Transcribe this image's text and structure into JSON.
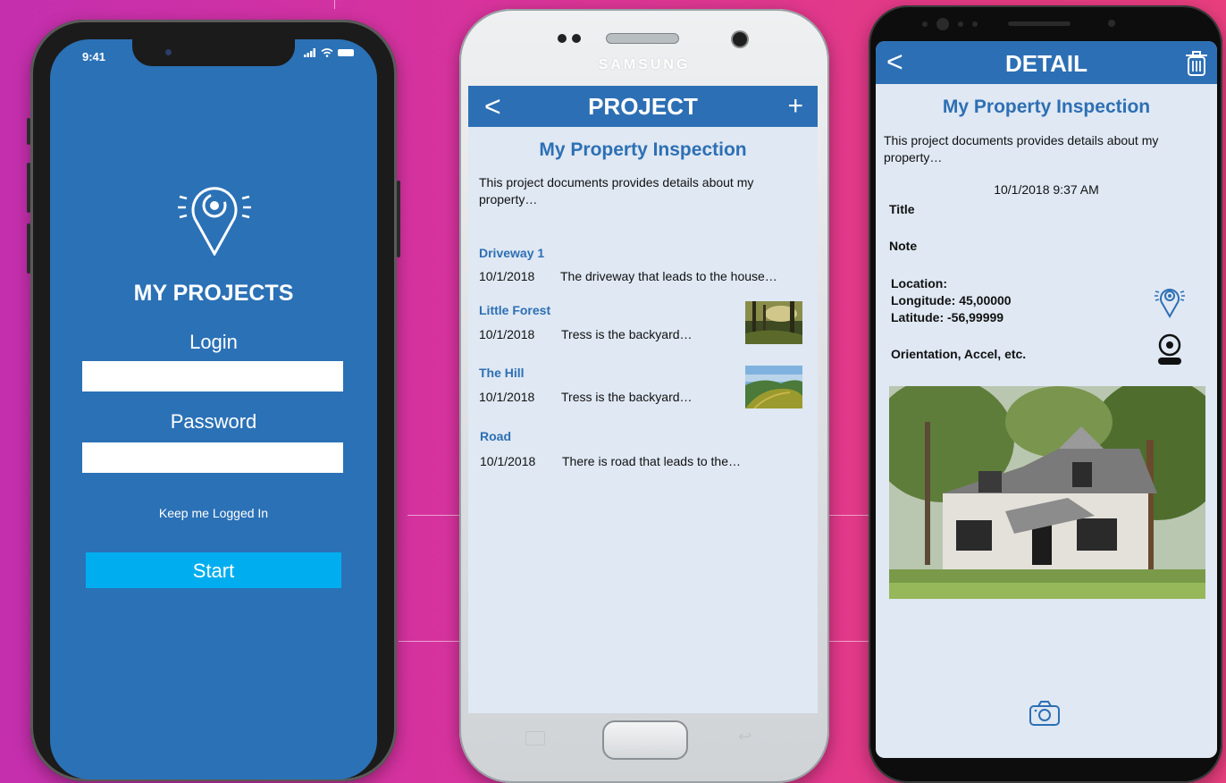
{
  "login_screen": {
    "status_time": "9:41",
    "title": "MY PROJECTS",
    "login_label": "Login",
    "login_value": "",
    "password_label": "Password",
    "password_value": "",
    "keep_logged_in": "Keep me Logged In",
    "start_button": "Start",
    "icons": [
      "location-pin-logo-icon",
      "signal-icon",
      "wifi-icon",
      "battery-icon"
    ]
  },
  "project_screen": {
    "brand": "SAMSUNG",
    "header_title": "PROJECT",
    "back_glyph": "<",
    "add_glyph": "+",
    "project_title": "My Property Inspection",
    "description": "This project documents provides details about my property…",
    "items": [
      {
        "title": "Driveway 1",
        "date": "10/1/2018",
        "text": "The driveway that leads to the house…",
        "thumbnail": null
      },
      {
        "title": "Little Forest",
        "date": "10/1/2018",
        "text": "Tress is the backyard…",
        "thumbnail": "forest-thumbnail"
      },
      {
        "title": "The Hill",
        "date": "10/1/2018",
        "text": "Tress is the backyard…",
        "thumbnail": "hill-thumbnail"
      },
      {
        "title": "Road",
        "date": "10/1/2018",
        "text": "There is road that leads to the…",
        "thumbnail": null
      }
    ]
  },
  "detail_screen": {
    "header_title": "DETAIL",
    "back_glyph": "<",
    "project_title": "My Property Inspection",
    "description": "This project documents provides details about my property…",
    "timestamp": "10/1/2018 9:37 AM",
    "title_label": "Title",
    "note_label": "Note",
    "location_label": "Location:",
    "longitude": "Longitude: 45,00000",
    "latitude": "Latitude: -56,99999",
    "orientation": "Orientation, Accel, etc.",
    "icons": [
      "trash-icon",
      "location-pin-icon",
      "orientation-icon",
      "camera-icon"
    ]
  },
  "colors": {
    "brand_blue": "#2d6fb4",
    "start_button": "#00aeef",
    "screen_background": "#dfe8f3"
  }
}
